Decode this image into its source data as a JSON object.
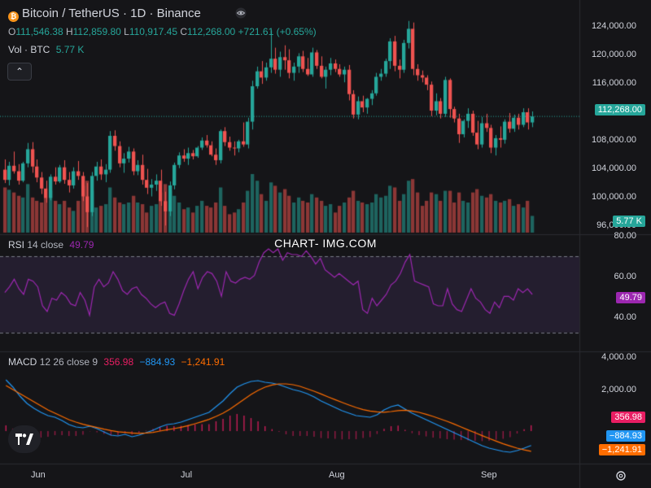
{
  "header": {
    "title": "Bitcoin / TetherUS · 1D · Binance",
    "ohlc": {
      "o_label": "O",
      "o_value": "111,546.38",
      "h_label": "H",
      "h_value": "112,859.80",
      "l_label": "L",
      "l_value": "110,917.45",
      "c_label": "C",
      "c_value": "112,268.00",
      "change": "+721.61 (+0.65%)"
    },
    "volume_label": "Vol · BTC",
    "volume_value": "5.77 K",
    "collapse_icon": "chevron-up-icon"
  },
  "rsi_header": {
    "label": "RSI",
    "params": "14 close",
    "value": "49.79"
  },
  "macd_header": {
    "label": "MACD",
    "params": "12 26 close 9",
    "v1": "356.98",
    "v2": "−884.93",
    "v3": "−1,241.91"
  },
  "watermark": "CHART- IMG.COM",
  "price_tag": "112,268.00",
  "volume_tag": "5.77 K",
  "rsi_tag": "49.79",
  "macd_tags": {
    "hist": "356.98",
    "macd": "−884.93",
    "signal": "−1,241.91"
  },
  "price_axis": [
    "124,000.00",
    "120,000.00",
    "116,000.00",
    "108,000.00",
    "104,000.00",
    "100,000.00",
    "96,000.00"
  ],
  "rsi_axis": [
    "80.00",
    "60.00",
    "40.00"
  ],
  "macd_axis": [
    "4,000.00",
    "2,000.00"
  ],
  "x_axis": [
    "Jun",
    "Jul",
    "Aug",
    "Sep"
  ],
  "colors": {
    "up": "#26a69a",
    "down": "#ef5350",
    "rsi": "#9c27b0",
    "macd": "#2196f3",
    "signal": "#ff6d00",
    "hist_pos": "#e91e63",
    "hist_neg": "#e91e63",
    "bg": "#151518"
  },
  "chart_data": [
    {
      "type": "candlestick",
      "title": "Bitcoin / TetherUS · 1D · Binance",
      "candles": [
        [
          105500,
          106800,
          103800,
          104200
        ],
        [
          104200,
          106500,
          103500,
          106000
        ],
        [
          106000,
          107800,
          105000,
          105300
        ],
        [
          105300,
          106200,
          103600,
          104100
        ],
        [
          104100,
          106500,
          103900,
          106300
        ],
        [
          106300,
          108900,
          105800,
          108100
        ],
        [
          108100,
          109000,
          105100,
          105900
        ],
        [
          105900,
          106800,
          103900,
          104500
        ],
        [
          104500,
          105200,
          102400,
          103100
        ],
        [
          103100,
          104100,
          101300,
          101900
        ],
        [
          101900,
          104900,
          101600,
          104600
        ],
        [
          104600,
          105800,
          103600,
          104000
        ],
        [
          104000,
          106100,
          103800,
          105800
        ],
        [
          105800,
          106700,
          103700,
          104200
        ],
        [
          104200,
          105200,
          102600,
          103500
        ],
        [
          103500,
          105800,
          103100,
          105300
        ],
        [
          105300,
          106600,
          104200,
          104700
        ],
        [
          104700,
          105200,
          101500,
          102100
        ],
        [
          102100,
          103800,
          98200,
          100100
        ],
        [
          100100,
          105200,
          99600,
          104700
        ],
        [
          104700,
          106500,
          104100,
          105900
        ],
        [
          105900,
          106800,
          104200,
          104900
        ],
        [
          104900,
          106200,
          103900,
          105500
        ],
        [
          105500,
          110400,
          105100,
          109800
        ],
        [
          109800,
          110500,
          107900,
          108500
        ],
        [
          108500,
          109100,
          105800,
          106300
        ],
        [
          106300,
          107600,
          105100,
          106900
        ],
        [
          106900,
          108400,
          106400,
          107800
        ],
        [
          107800,
          108200,
          104800,
          105300
        ],
        [
          105300,
          106700,
          104800,
          106100
        ],
        [
          106100,
          107400,
          103600,
          104200
        ],
        [
          104200,
          105600,
          102400,
          103200
        ],
        [
          103200,
          104300,
          102100,
          103600
        ],
        [
          103600,
          104900,
          102800,
          104100
        ],
        [
          104100,
          105500,
          100900,
          101500
        ],
        [
          101500,
          102700,
          98400,
          100200
        ],
        [
          100200,
          104000,
          99600,
          103500
        ],
        [
          103500,
          106400,
          103000,
          106100
        ],
        [
          106100,
          107700,
          105700,
          107300
        ],
        [
          107300,
          108100,
          106500,
          106900
        ],
        [
          106900,
          108300,
          106100,
          107600
        ],
        [
          107600,
          108000,
          106800,
          107200
        ],
        [
          107200,
          108500,
          107000,
          108300
        ],
        [
          108300,
          109600,
          108000,
          109200
        ],
        [
          109200,
          109900,
          108300,
          108600
        ],
        [
          108600,
          109100,
          107200,
          107400
        ],
        [
          107400,
          108200,
          106100,
          106700
        ],
        [
          106700,
          110600,
          106300,
          110400
        ],
        [
          110400,
          110900,
          108500,
          109000
        ],
        [
          109000,
          109700,
          107900,
          108300
        ],
        [
          108300,
          109100,
          107300,
          108200
        ],
        [
          108200,
          109300,
          107700,
          109100
        ],
        [
          109100,
          111500,
          108400,
          108700
        ],
        [
          108700,
          112100,
          108200,
          111600
        ],
        [
          111600,
          116800,
          110600,
          116100
        ],
        [
          116100,
          118600,
          115800,
          118000
        ],
        [
          118000,
          119300,
          116400,
          117200
        ],
        [
          117200,
          119100,
          116800,
          118500
        ],
        [
          118500,
          123200,
          117800,
          119600
        ],
        [
          119600,
          121000,
          117700,
          118200
        ],
        [
          118200,
          120500,
          117300,
          119800
        ],
        [
          119800,
          121300,
          118200,
          119400
        ],
        [
          119400,
          120800,
          117100,
          117800
        ],
        [
          117800,
          119100,
          116800,
          118600
        ],
        [
          118600,
          120300,
          117800,
          119900
        ],
        [
          119900,
          120600,
          117900,
          118300
        ],
        [
          118300,
          119700,
          117400,
          117600
        ],
        [
          117600,
          121000,
          117300,
          120400
        ],
        [
          120400,
          120700,
          118300,
          118700
        ],
        [
          118700,
          119900,
          117100,
          117300
        ],
        [
          117300,
          118600,
          115800,
          118200
        ],
        [
          118200,
          119700,
          117500,
          119000
        ],
        [
          119000,
          119500,
          117900,
          118300
        ],
        [
          118300,
          118900,
          117300,
          117600
        ],
        [
          117600,
          118600,
          116600,
          118200
        ],
        [
          118200,
          118800,
          114300,
          115100
        ],
        [
          115100,
          115600,
          112000,
          112500
        ],
        [
          112500,
          114800,
          111900,
          114200
        ],
        [
          114200,
          114900,
          112800,
          113400
        ],
        [
          113400,
          114600,
          112600,
          114500
        ],
        [
          114500,
          115600,
          113700,
          115200
        ],
        [
          115200,
          117800,
          114900,
          117300
        ],
        [
          117300,
          118300,
          116800,
          117700
        ],
        [
          117700,
          119600,
          117300,
          119300
        ],
        [
          119300,
          122200,
          118300,
          121800
        ],
        [
          121800,
          122500,
          118000,
          118700
        ],
        [
          118700,
          119500,
          117100,
          118200
        ],
        [
          118200,
          122000,
          117800,
          121600
        ],
        [
          121600,
          124400,
          120900,
          123400
        ],
        [
          123400,
          124200,
          117500,
          118300
        ],
        [
          118300,
          118900,
          116800,
          117500
        ],
        [
          117500,
          118100,
          116600,
          117200
        ],
        [
          117200,
          117500,
          115600,
          116300
        ],
        [
          116300,
          116700,
          112300,
          113000
        ],
        [
          113000,
          115200,
          112400,
          114200
        ],
        [
          114200,
          114600,
          112000,
          112600
        ],
        [
          112600,
          117300,
          112200,
          116900
        ],
        [
          116900,
          117100,
          112100,
          113200
        ],
        [
          113200,
          113500,
          111500,
          112000
        ],
        [
          112000,
          112600,
          108900,
          110000
        ],
        [
          110000,
          111900,
          109600,
          111700
        ],
        [
          111700,
          113300,
          110800,
          112600
        ],
        [
          112600,
          113000,
          109800,
          110200
        ],
        [
          110200,
          111700,
          108100,
          108700
        ],
        [
          108700,
          112200,
          108300,
          111400
        ],
        [
          111400,
          112600,
          110300,
          110800
        ],
        [
          110800,
          111200,
          107600,
          108300
        ],
        [
          108300,
          109900,
          107300,
          109500
        ],
        [
          109500,
          111000,
          108300,
          109300
        ],
        [
          109300,
          111900,
          108800,
          111600
        ],
        [
          111600,
          112700,
          110200,
          110700
        ],
        [
          110700,
          112500,
          110300,
          112100
        ],
        [
          112100,
          112600,
          110600,
          111200
        ],
        [
          111200,
          113300,
          110900,
          112800
        ],
        [
          112800,
          113300,
          110600,
          111500
        ],
        [
          111500,
          112900,
          110900,
          112268
        ]
      ],
      "volume": [
        1.35,
        1.28,
        1.2,
        1.1,
        1.05,
        1.45,
        1.05,
        0.95,
        0.9,
        1.05,
        1.25,
        0.95,
        0.85,
        0.95,
        0.75,
        0.65,
        0.95,
        1.4,
        1.55,
        1.25,
        0.75,
        0.8,
        0.85,
        1.35,
        1.05,
        0.9,
        0.85,
        0.9,
        1.1,
        0.9,
        0.85,
        0.6,
        0.8,
        0.85,
        1.2,
        1.45,
        1.25,
        1.1,
        0.9,
        0.7,
        0.75,
        0.6,
        0.8,
        0.95,
        0.8,
        0.75,
        0.9,
        1.35,
        0.8,
        0.55,
        0.6,
        0.7,
        0.9,
        1.25,
        1.75,
        1.55,
        1.15,
        0.95,
        1.5,
        1.4,
        1.2,
        1.3,
        1.1,
        0.9,
        1.05,
        0.95,
        0.9,
        1.15,
        1.05,
        0.95,
        0.8,
        0.85,
        0.6,
        0.8,
        0.9,
        1.05,
        1.25,
        0.95,
        0.9,
        0.85,
        0.9,
        1.15,
        1.05,
        1.1,
        1.4,
        1.35,
        0.95,
        1.15,
        1.55,
        1.6,
        1.2,
        0.8,
        0.95,
        1.2,
        1.15,
        0.95,
        1.25,
        1.25,
        0.9,
        1.2,
        0.95,
        0.9,
        1.2,
        1.3,
        1.1,
        1.05,
        1.15,
        0.95,
        0.9,
        0.95,
        1.0,
        0.8,
        0.85,
        0.75,
        0.95,
        0.5,
        0.35
      ],
      "volume_unit": "K BTC",
      "price_range": [
        97500,
        125200
      ],
      "grid": false
    },
    {
      "type": "line",
      "title": "RSI 14 close",
      "values": [
        51,
        54,
        58,
        53,
        50,
        58,
        57,
        54,
        44,
        41,
        48,
        47,
        51,
        49,
        45,
        44,
        51,
        47,
        39,
        54,
        58,
        54,
        56,
        62,
        58,
        52,
        50,
        53,
        54,
        50,
        48,
        45,
        43,
        45,
        46,
        40,
        39,
        45,
        52,
        58,
        62,
        53,
        59,
        62,
        61,
        57,
        49,
        62,
        57,
        56,
        58,
        59,
        58,
        60,
        67,
        72,
        74,
        72,
        74,
        68,
        72,
        71,
        71,
        70,
        73,
        70,
        66,
        69,
        63,
        61,
        59,
        61,
        59,
        57,
        55,
        57,
        42,
        40,
        48,
        44,
        47,
        50,
        55,
        57,
        61,
        67,
        71,
        57,
        56,
        55,
        54,
        45,
        44,
        44,
        53,
        45,
        42,
        41,
        47,
        53,
        48,
        46,
        42,
        40,
        46,
        43,
        49,
        49,
        47,
        53,
        51,
        53,
        50
      ],
      "ylim": [
        20,
        80
      ],
      "bands": [
        30,
        70
      ]
    },
    {
      "type": "macd",
      "title": "MACD 12 26 close 9",
      "macd": [
        3150,
        2700,
        2150,
        1700,
        1400,
        1150,
        950,
        850,
        650,
        400,
        250,
        200,
        300,
        150,
        -50,
        -250,
        -300,
        -200,
        -350,
        -250,
        -100,
        50,
        250,
        400,
        450,
        550,
        700,
        850,
        1000,
        1150,
        1500,
        1850,
        2300,
        2700,
        2900,
        3050,
        3100,
        3000,
        2950,
        2850,
        2700,
        2550,
        2450,
        2300,
        2100,
        1850,
        1650,
        1450,
        1250,
        1100,
        950,
        900,
        850,
        1000,
        1300,
        1500,
        1600,
        1350,
        1100,
        900,
        700,
        500,
        300,
        100,
        -100,
        -300,
        -500,
        -700,
        -900,
        -1050,
        -1150,
        -1250,
        -1300,
        -1200,
        -1050,
        -885
      ],
      "signal": [
        2800,
        2550,
        2300,
        2050,
        1800,
        1550,
        1300,
        1100,
        900,
        700,
        550,
        420,
        320,
        220,
        120,
        30,
        -40,
        -80,
        -120,
        -140,
        -120,
        -80,
        0,
        80,
        150,
        230,
        330,
        450,
        580,
        720,
        900,
        1100,
        1350,
        1650,
        1950,
        2250,
        2500,
        2700,
        2830,
        2900,
        2900,
        2850,
        2750,
        2600,
        2450,
        2280,
        2100,
        1930,
        1760,
        1600,
        1450,
        1320,
        1230,
        1180,
        1160,
        1200,
        1260,
        1280,
        1230,
        1150,
        1030,
        900,
        750,
        600,
        430,
        250,
        70,
        -100,
        -280,
        -450,
        -620,
        -780,
        -920,
        -1050,
        -1160,
        -1242
      ],
      "histogram_last": 356.98,
      "ylim": [
        -2000,
        4500
      ]
    }
  ]
}
